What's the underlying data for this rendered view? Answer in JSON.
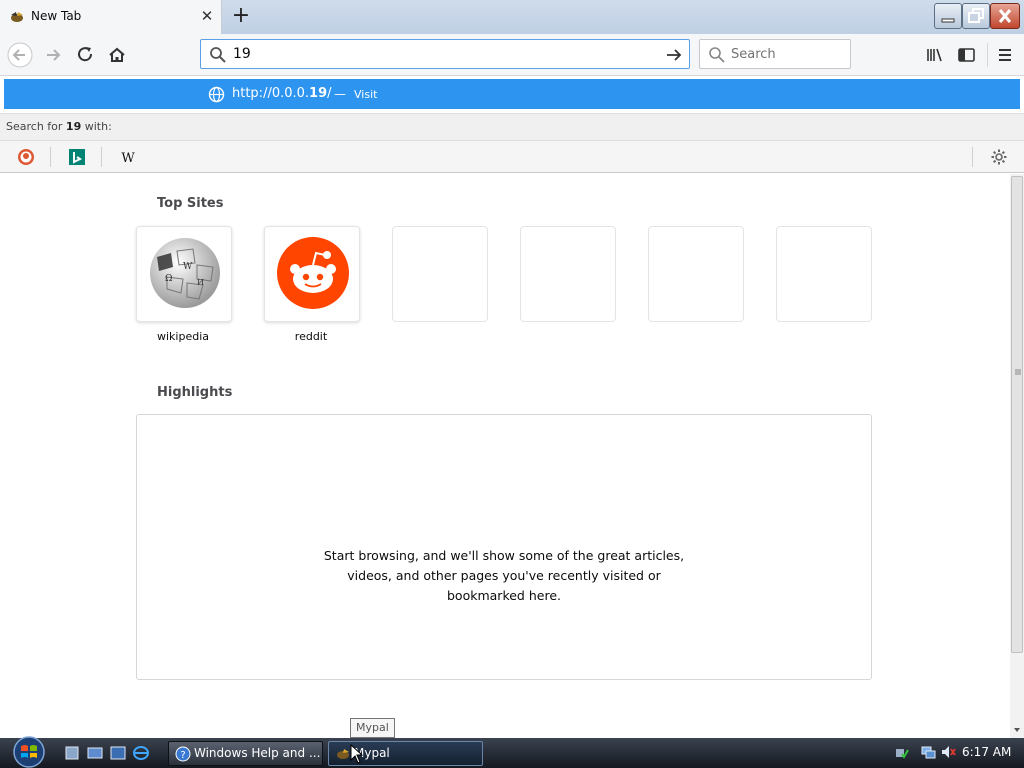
{
  "tab": {
    "title": "New Tab"
  },
  "urlbar": {
    "value": "19"
  },
  "searchbar": {
    "placeholder": "Search"
  },
  "suggestion": {
    "url_prefix": "http://0.0.0.",
    "url_bold": "19",
    "url_suffix": "/",
    "separator": "—",
    "action": "Visit"
  },
  "search_for": {
    "prefix": "Search for ",
    "term": "19",
    "suffix": " with:"
  },
  "search_engines": [
    "duckduckgo-icon",
    "bing-icon",
    "wikipedia-icon"
  ],
  "content": {
    "top_sites_title": "Top Sites",
    "top_sites": [
      {
        "label": "wikipedia",
        "icon": "wikipedia-globe-icon"
      },
      {
        "label": "reddit",
        "icon": "reddit-icon"
      },
      {
        "label": ""
      },
      {
        "label": ""
      },
      {
        "label": ""
      },
      {
        "label": ""
      }
    ],
    "highlights_title": "Highlights",
    "highlights_line1": "Start browsing, and we'll show some of the great articles,",
    "highlights_line2": "videos, and other pages you've recently visited or",
    "highlights_line3": "bookmarked here."
  },
  "tooltip": "Mypal",
  "taskbar": {
    "tasks": [
      {
        "label": "Windows Help and ...",
        "icon": "help-icon"
      },
      {
        "label": "Mypal",
        "icon": "mypal-icon"
      }
    ],
    "clock": "6:17 AM"
  },
  "colors": {
    "accent": "#2d94f0",
    "reddit": "#ff4500"
  }
}
